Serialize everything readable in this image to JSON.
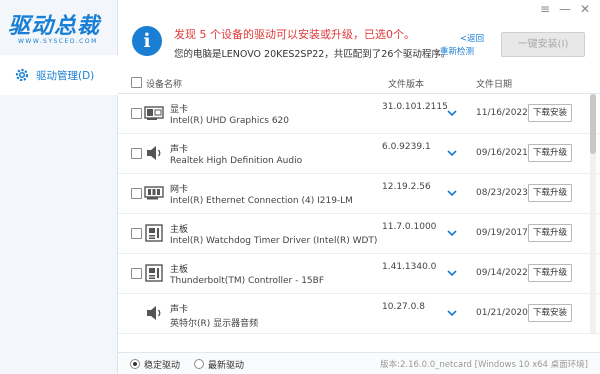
{
  "app": {
    "logo_text": "驱动总裁",
    "logo_sub": "WWW.SYSCEO.COM"
  },
  "sidebar": {
    "items": [
      {
        "label": "驱动管理(D)",
        "icon": "gear-icon",
        "selected": true
      }
    ]
  },
  "header": {
    "notice": "发现 5 个设备的驱动可以安装或升级，已选0个。",
    "subnotice": "您的电脑是LENOVO 20KES2SP22，共匹配到了26个驱动程序。",
    "back_label": "<返回",
    "recheck_label": "重新检测",
    "install_all_label": "一键安装(I)",
    "window_controls": [
      "≡",
      "—",
      "✕"
    ]
  },
  "table": {
    "columns": {
      "device": "设备名称",
      "version": "文件版本",
      "date": "文件日期"
    },
    "rows": [
      {
        "category": "显卡",
        "name": "Intel(R) UHD Graphics 620",
        "version": "31.0.101.2115",
        "date": "11/16/2022",
        "action": "下载安装",
        "icon": "graphics-card-icon"
      },
      {
        "category": "声卡",
        "name": "Realtek High Definition Audio",
        "version": "6.0.9239.1",
        "date": "09/16/2021",
        "action": "下载升级",
        "icon": "speaker-icon"
      },
      {
        "category": "网卡",
        "name": "Intel(R) Ethernet Connection (4) I219-LM",
        "version": "12.19.2.56",
        "date": "08/23/2023",
        "action": "下载升级",
        "icon": "network-card-icon"
      },
      {
        "category": "主板",
        "name": "Intel(R) Watchdog Timer Driver (Intel(R) WDT)",
        "version": "11.7.0.1000",
        "date": "09/19/2017",
        "action": "下载升级",
        "icon": "motherboard-icon"
      },
      {
        "category": "主板",
        "name": "Thunderbolt(TM) Controller - 15BF",
        "version": "1.41.1340.0",
        "date": "09/14/2022",
        "action": "下载升级",
        "icon": "motherboard-icon"
      },
      {
        "category": "声卡",
        "name": "英特尔(R) 显示器音频",
        "version": "10.27.0.8",
        "date": "01/21/2020",
        "action": "下载安装",
        "icon": "speaker-icon"
      }
    ]
  },
  "footer": {
    "options": [
      {
        "label": "稳定驱动",
        "selected": true
      },
      {
        "label": "最新驱动",
        "selected": false
      }
    ],
    "version": "版本:2.16.0.0_netcard [Windows 10 x64 桌面环境]"
  },
  "colors": {
    "accent": "#1a7fd4",
    "warning": "#e03a3a"
  }
}
